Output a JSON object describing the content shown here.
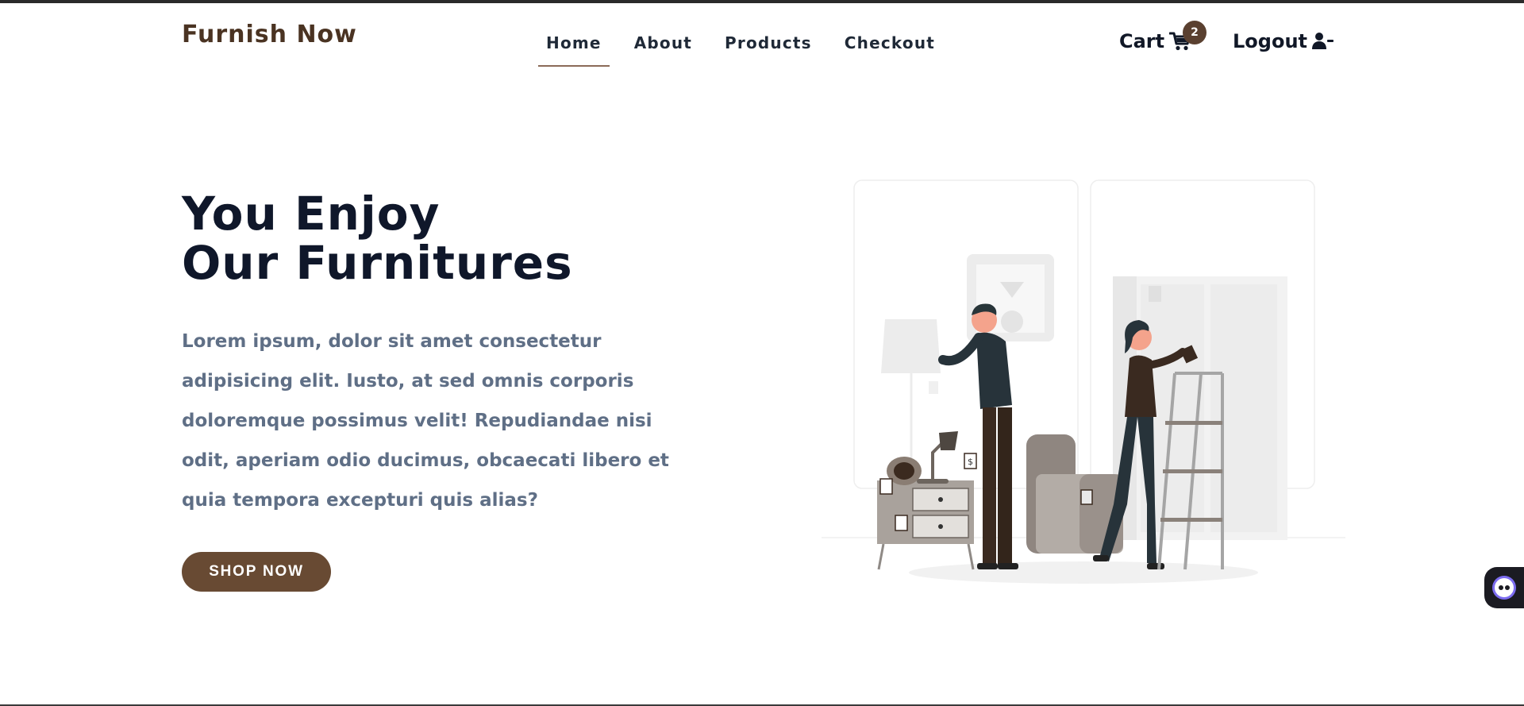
{
  "header": {
    "brand": "Furnish Now",
    "nav": [
      {
        "label": "Home",
        "active": true
      },
      {
        "label": "About",
        "active": false
      },
      {
        "label": "Products",
        "active": false
      },
      {
        "label": "Checkout",
        "active": false
      }
    ],
    "cart_label": "Cart",
    "cart_count": "2",
    "logout_label": "Logout"
  },
  "hero": {
    "title_line1": "You Enjoy",
    "title_line2": "Our Furnitures",
    "text": "Lorem ipsum, dolor sit amet consectetur adipisicing elit. Iusto, at sed omnis corporis doloremque possimus velit! Repudiandae nisi odit, aperiam odio ducimus, obcaecati libero et quia tempora excepturi quis alias?",
    "button": "SHOP NOW"
  },
  "illustration": {
    "price_tag": "$"
  },
  "colors": {
    "brand": "#4a3322",
    "accent": "#684a33",
    "badge": "#5a4030",
    "body_text": "#5f6f86",
    "heading": "#0f172a"
  },
  "icons": {
    "cart": "cart-icon",
    "logout": "user-minus-icon",
    "widget": "assistant-icon"
  }
}
